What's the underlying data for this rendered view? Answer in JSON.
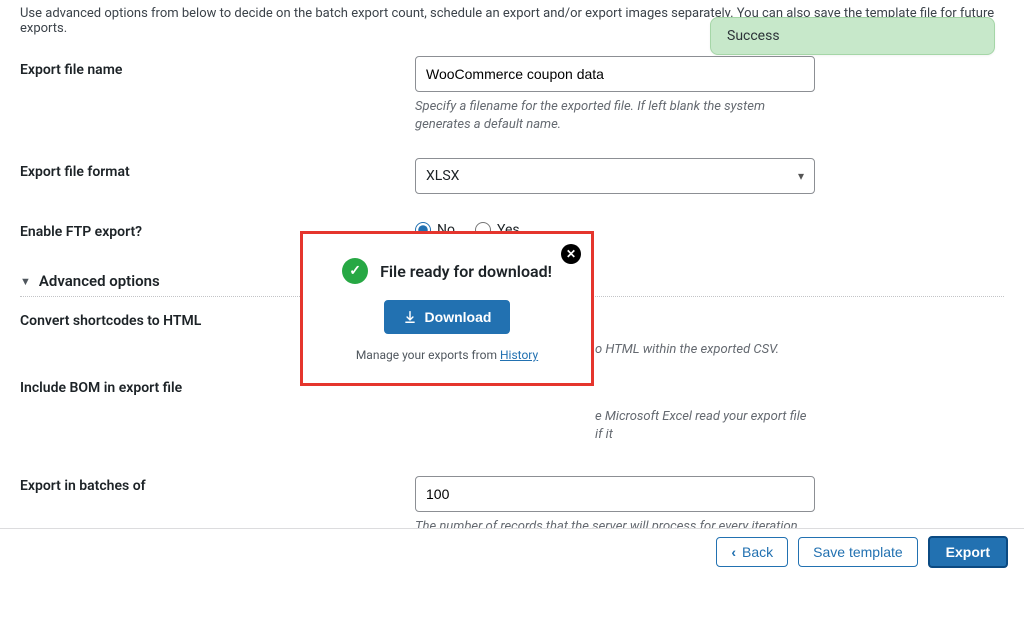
{
  "intro": "Use advanced options from below to decide on the batch export count, schedule an export and/or export images separately. You can also save the template file for future exports.",
  "toast": {
    "text": "Success"
  },
  "form": {
    "filename": {
      "label": "Export file name",
      "value": "WooCommerce coupon data",
      "help": "Specify a filename for the exported file. If left blank the system generates a default name."
    },
    "format": {
      "label": "Export file format",
      "value": "XLSX"
    },
    "ftp": {
      "label": "Enable FTP export?",
      "no": "No",
      "yes": "Yes",
      "selected": "no"
    }
  },
  "advanced": {
    "section_title": "Advanced options",
    "convert_shortcodes": {
      "label": "Convert shortcodes to HTML",
      "help_suffix": "o HTML within the exported CSV."
    },
    "include_bom": {
      "label": "Include BOM in export file",
      "help_suffix": "e Microsoft Excel read your export file if it"
    },
    "batches": {
      "label": "Export in batches of",
      "value": "100",
      "help": "The number of records that the server will process for every iteration within the configured timeout interval. If the export fails due to timeout you can lower this number accordingly and try again"
    }
  },
  "modal": {
    "title": "File ready for download!",
    "download_btn": "Download",
    "manage_prefix": "Manage your exports from ",
    "history_link": "History"
  },
  "footer": {
    "back": "Back",
    "save_template": "Save template",
    "export": "Export"
  }
}
